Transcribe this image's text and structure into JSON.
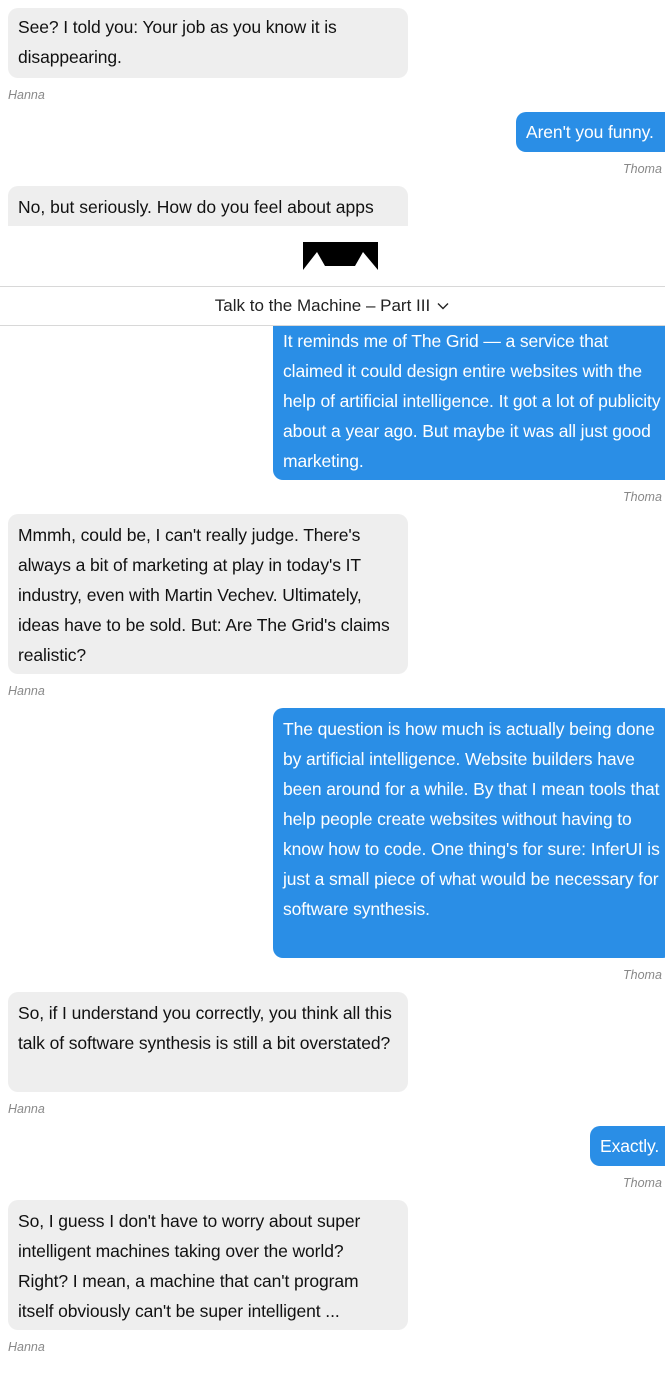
{
  "top_messages": [
    {
      "text": "See? I told you: Your job as you know it is disappearing.",
      "sender": "Hanna"
    },
    {
      "text": "Aren't you funny.",
      "sender": "Thoma"
    },
    {
      "text": "No, but seriously. How do you feel about apps"
    }
  ],
  "section": {
    "title": "Talk to the Machine – Part III",
    "logo_icon": "mountains-logo-icon",
    "chevron_icon": "chevron-down-icon"
  },
  "messages": [
    {
      "text": "It reminds me of The Grid — a service that claimed it could design entire websites with the help of artificial intelligence. It got a lot of publicity about a year ago. But maybe it was all just good marketing.",
      "sender": "Thoma"
    },
    {
      "text": "Mmmh, could be, I can't really judge. There's always a bit of marketing at play in today's IT industry, even with Martin Vechev. Ultimately, ideas have to be sold. But: Are The Grid's claims realistic?",
      "sender": "Hanna"
    },
    {
      "text": "The question is how much is actually being done by artificial intelligence. Website builders have been around for a while. By that I mean tools that help people create websites without having to know how to code. One thing's for sure: InferUI is just a small piece of what would be necessary for software synthesis.",
      "sender": "Thoma"
    },
    {
      "text": "So, if I understand you correctly, you think all this talk of software synthesis is still a bit overstated?",
      "sender": "Hanna"
    },
    {
      "text": "Exactly.",
      "sender": "Thoma"
    },
    {
      "text": "So, I guess I don't have to worry about super intelligent machines taking over the world? Right? I mean, a machine that can't program itself obviously can't be super intelligent ...",
      "sender": "Hanna"
    }
  ],
  "colors": {
    "outgoing_bubble": "#2a8ee6",
    "incoming_bubble": "#eeeeee",
    "sender_label": "#888888"
  }
}
